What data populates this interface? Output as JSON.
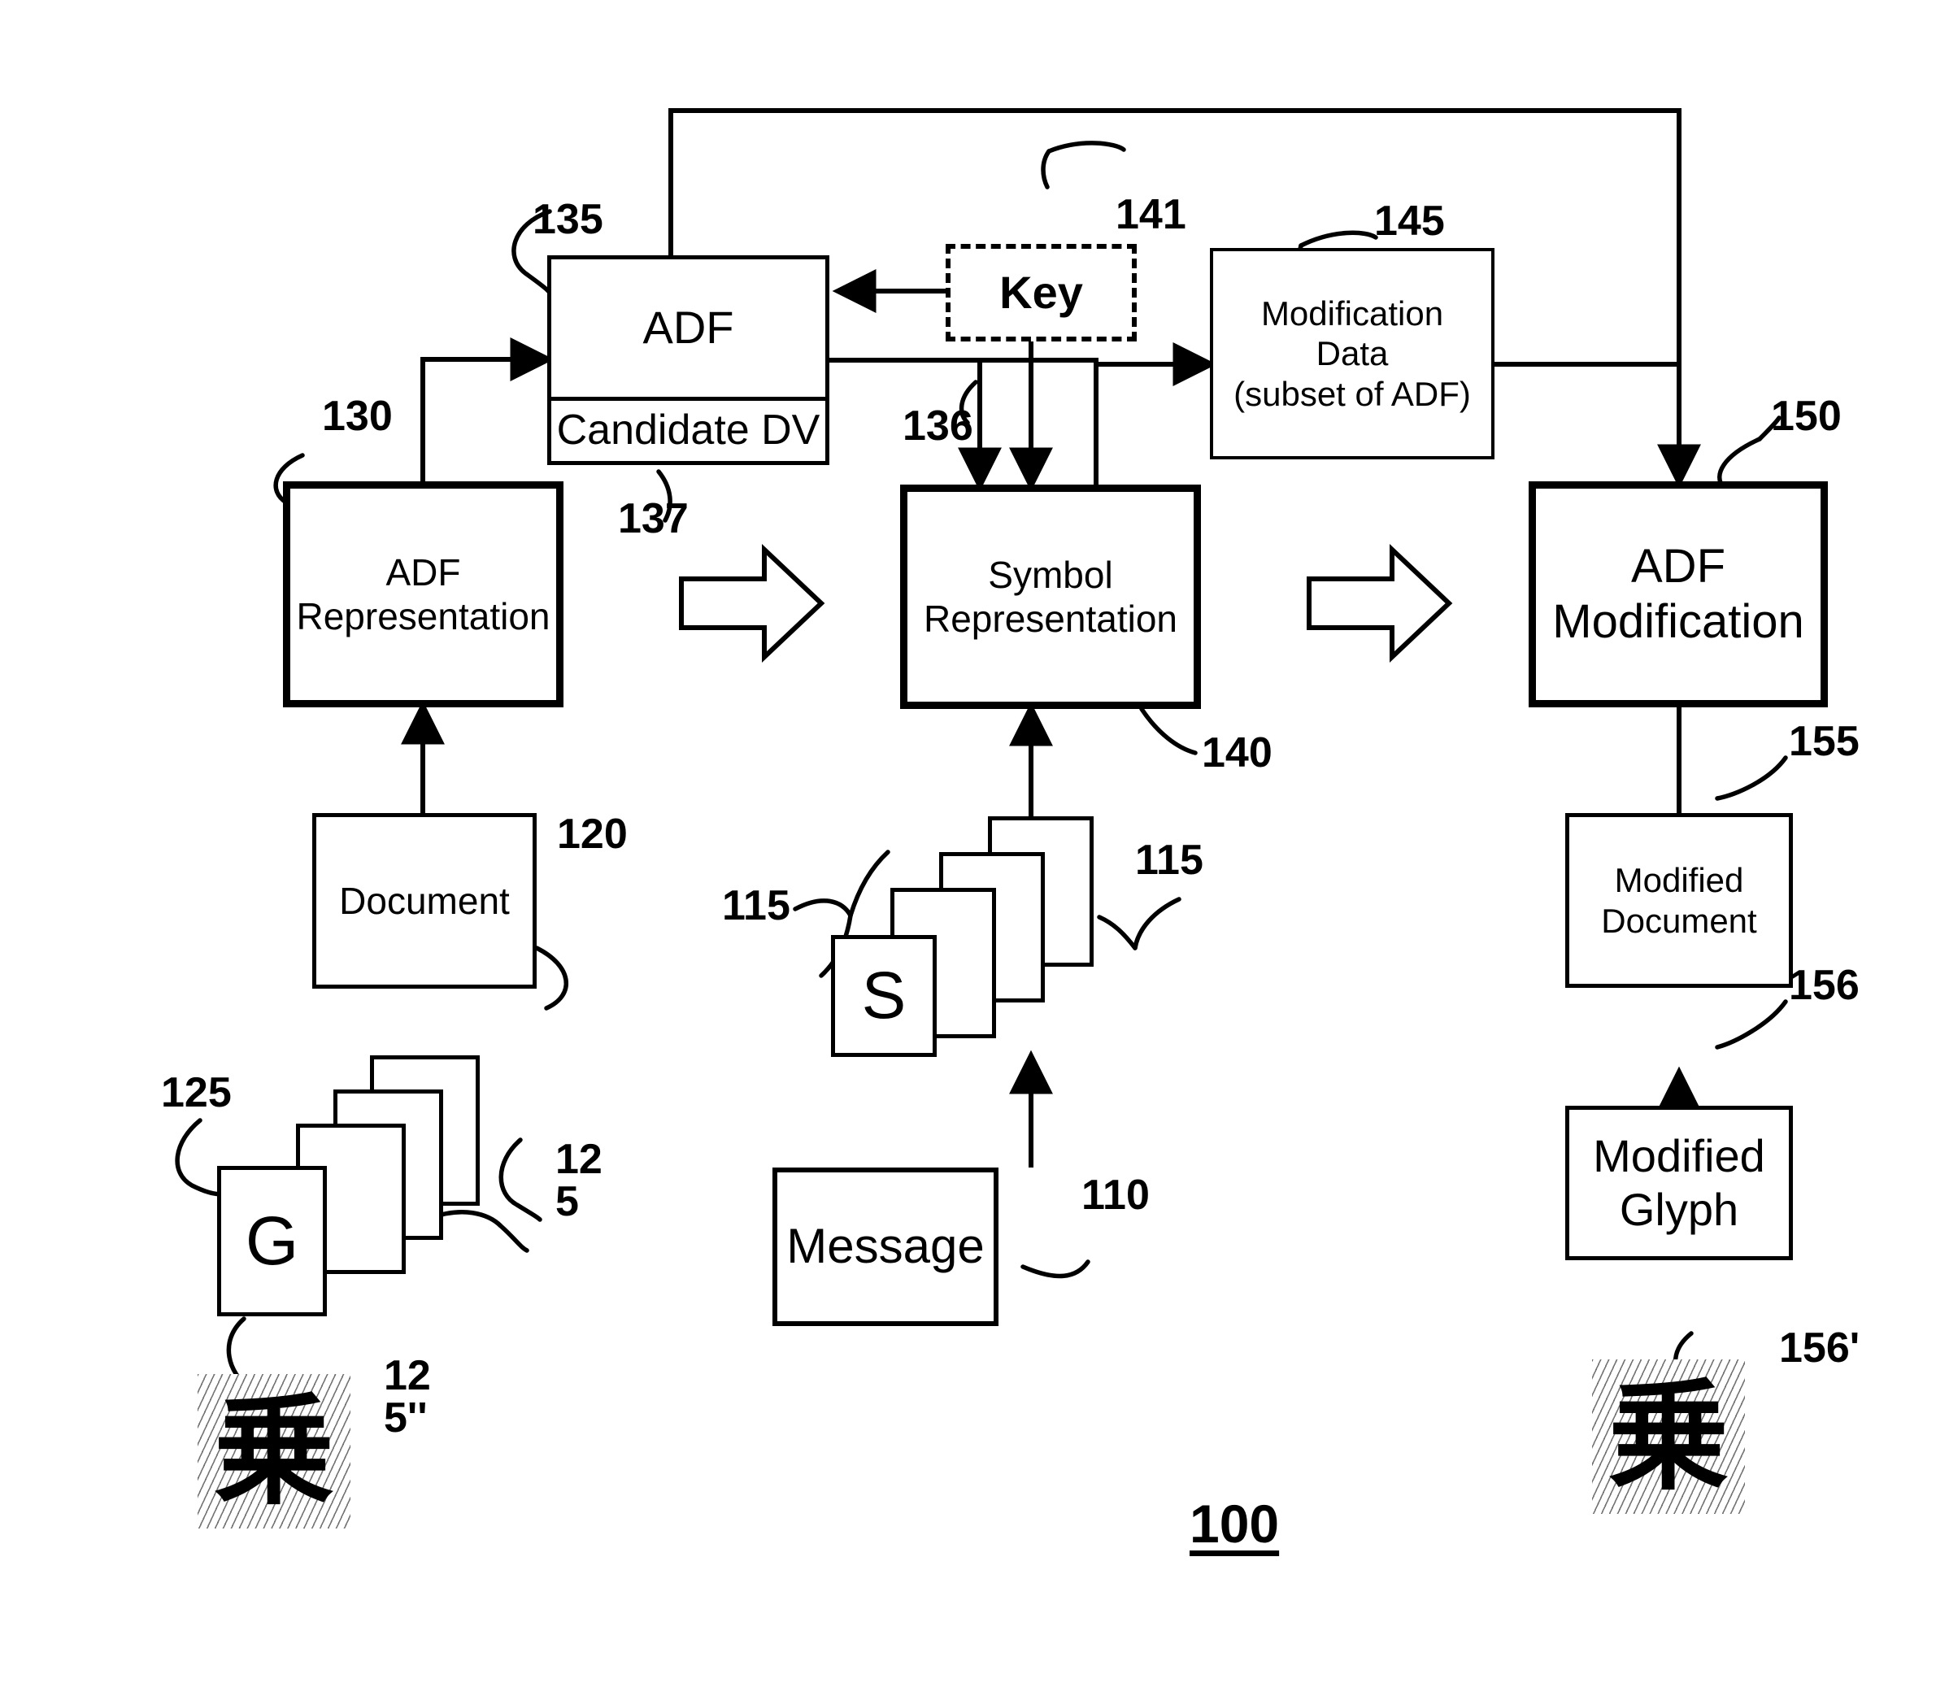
{
  "figure": {
    "number": "100"
  },
  "boxes": {
    "adf": {
      "title": "ADF",
      "subtitle": "Candidate DV",
      "ref": "135"
    },
    "key": {
      "label": "Key",
      "ref": "141"
    },
    "modification_data": {
      "line1": "Modification",
      "line2": "Data",
      "line3": "(subset of ADF)",
      "ref": "145"
    },
    "adf_representation": {
      "line1": "ADF",
      "line2": "Representation",
      "ref": "130"
    },
    "symbol_representation": {
      "line1": "Symbol",
      "line2": "Representation",
      "ref": "140"
    },
    "adf_modification": {
      "line1": "ADF",
      "line2": "Modification",
      "ref": "150"
    },
    "document": {
      "label": "Document",
      "ref": "120"
    },
    "message": {
      "label": "Message",
      "ref": "110"
    },
    "modified_document": {
      "line1": "Modified",
      "line2": "Document",
      "ref": "155"
    },
    "modified_glyph": {
      "line1": "Modified",
      "line2": "Glyph",
      "ref": "156"
    }
  },
  "stacks": {
    "glyph_stack": {
      "card_label": "G",
      "ref_left": "125",
      "ref_right": "12\n5"
    },
    "symbol_stack": {
      "card_label": "S",
      "ref_left": "115",
      "ref_right": "115"
    }
  },
  "glyphs": {
    "original": {
      "character": "乗",
      "ref": "12\n5''"
    },
    "modified": {
      "character": "乗",
      "ref": "156'"
    }
  },
  "arrow_refs": {
    "adf_to_symbol": "137",
    "adf_out": "136"
  },
  "colors": {
    "ink": "#000000",
    "paper": "#ffffff"
  }
}
